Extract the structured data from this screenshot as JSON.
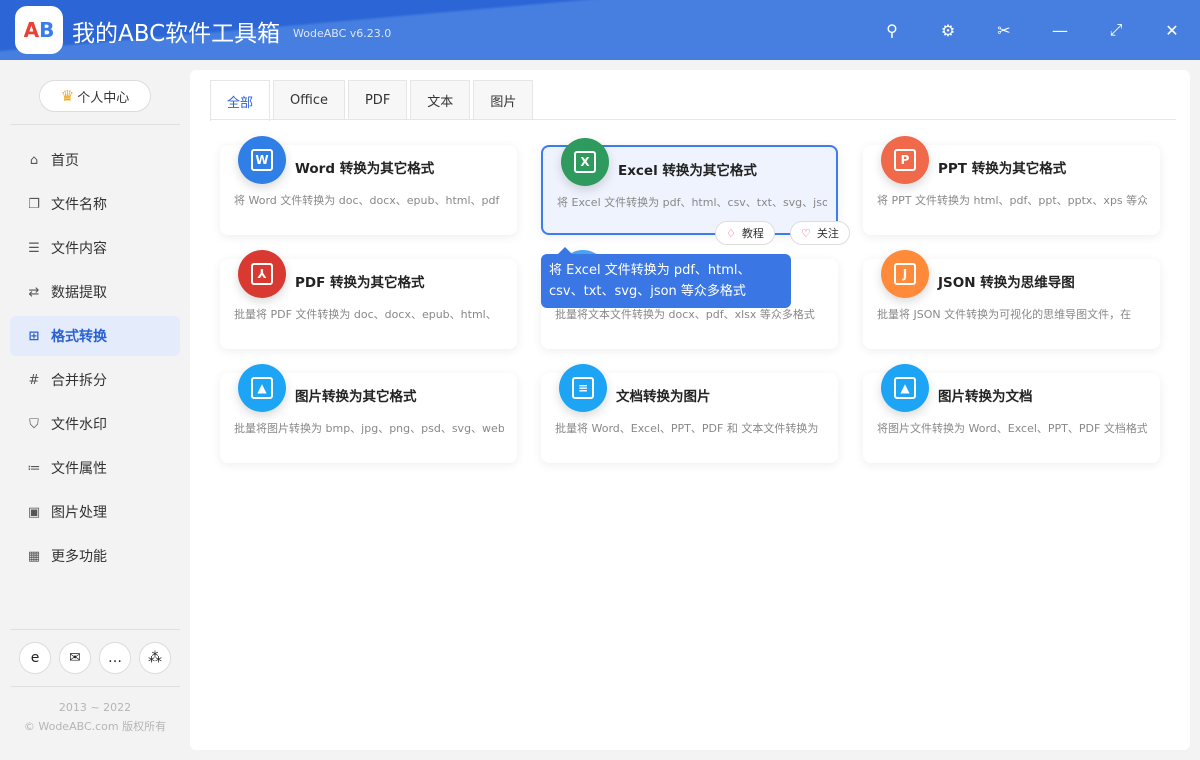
{
  "header": {
    "title": "我的ABC软件工具箱",
    "version": "WodeABC v6.23.0",
    "logo_text": "AB"
  },
  "sidebar": {
    "user_center": "个人中心",
    "items": [
      {
        "label": "首页",
        "icon": "⌂"
      },
      {
        "label": "文件名称",
        "icon": "❐"
      },
      {
        "label": "文件内容",
        "icon": "☰"
      },
      {
        "label": "数据提取",
        "icon": "⇄"
      },
      {
        "label": "格式转换",
        "icon": "⊞"
      },
      {
        "label": "合并拆分",
        "icon": "#"
      },
      {
        "label": "文件水印",
        "icon": "⛉"
      },
      {
        "label": "文件属性",
        "icon": "≔"
      },
      {
        "label": "图片处理",
        "icon": "▣"
      },
      {
        "label": "更多功能",
        "icon": "▦"
      }
    ],
    "copyright_years": "2013 ~ 2022",
    "copyright": "© WodeABC.com 版权所有"
  },
  "tabs": [
    "全部",
    "Office",
    "PDF",
    "文本",
    "图片"
  ],
  "cards": [
    {
      "title": "Word 转换为其它格式",
      "desc": "将 Word 文件转换为 doc、docx、epub、html、pdf",
      "glyph": "W",
      "color": "#2f7fe6"
    },
    {
      "title": "Excel 转换为其它格式",
      "desc": "将 Excel 文件转换为 pdf、html、csv、txt、svg、json",
      "glyph": "X",
      "color": "#2e9a5e"
    },
    {
      "title": "PPT 转换为其它格式",
      "desc": "将 PPT 文件转换为 html、pdf、ppt、pptx、xps 等众",
      "glyph": "P",
      "color": "#f0694a"
    },
    {
      "title": "PDF 转换为其它格式",
      "desc": "批量将 PDF 文件转换为 doc、docx、epub、html、",
      "glyph": "⅄",
      "color": "#d83a32"
    },
    {
      "title": "",
      "desc": "批量将文本文件转换为 docx、pdf、xlsx 等众多格式",
      "glyph": "",
      "color": "#4aa3f0"
    },
    {
      "title": "JSON 转换为思维导图",
      "desc": "批量将 JSON 文件转换为可视化的思维导图文件，在",
      "glyph": "J",
      "color": "#ff8a3a"
    },
    {
      "title": "图片转换为其它格式",
      "desc": "批量将图片转换为 bmp、jpg、png、psd、svg、webp",
      "glyph": "▲",
      "color": "#1ea4f5"
    },
    {
      "title": "文档转换为图片",
      "desc": "批量将 Word、Excel、PPT、PDF 和 文本文件转换为",
      "glyph": "≡",
      "color": "#1ea4f5"
    },
    {
      "title": "图片转换为文档",
      "desc": "将图片文件转换为 Word、Excel、PPT、PDF 文档格式",
      "glyph": "▲",
      "color": "#1ea4f5"
    }
  ],
  "card_actions": {
    "tutorial": "教程",
    "follow": "关注"
  },
  "tooltip": "将 Excel 文件转换为 pdf、html、csv、txt、svg、json 等众多格式"
}
